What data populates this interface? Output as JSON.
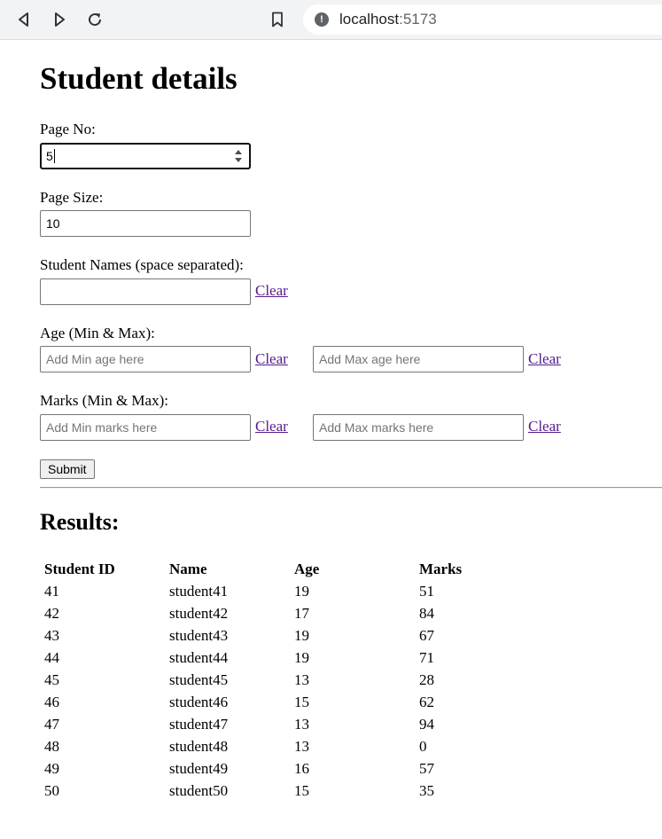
{
  "browser": {
    "url_host": "localhost",
    "url_port": ":5173"
  },
  "page": {
    "title": "Student details",
    "page_no": {
      "label": "Page No:",
      "value": "5"
    },
    "page_size": {
      "label": "Page Size:",
      "value": "10"
    },
    "names": {
      "label": "Student Names (space separated):",
      "value": "",
      "clear_label": "Clear"
    },
    "age": {
      "label": "Age (Min & Max):",
      "min_placeholder": "Add Min age here",
      "max_placeholder": "Add Max age here",
      "clear_label": "Clear"
    },
    "marks": {
      "label": "Marks (Min & Max):",
      "min_placeholder": "Add Min marks here",
      "max_placeholder": "Add Max marks here",
      "clear_label": "Clear"
    },
    "submit_label": "Submit",
    "results_title": "Results:"
  },
  "table": {
    "headers": [
      "Student ID",
      "Name",
      "Age",
      "Marks"
    ],
    "rows": [
      [
        "41",
        "student41",
        "19",
        "51"
      ],
      [
        "42",
        "student42",
        "17",
        "84"
      ],
      [
        "43",
        "student43",
        "19",
        "67"
      ],
      [
        "44",
        "student44",
        "19",
        "71"
      ],
      [
        "45",
        "student45",
        "13",
        "28"
      ],
      [
        "46",
        "student46",
        "15",
        "62"
      ],
      [
        "47",
        "student47",
        "13",
        "94"
      ],
      [
        "48",
        "student48",
        "13",
        "0"
      ],
      [
        "49",
        "student49",
        "16",
        "57"
      ],
      [
        "50",
        "student50",
        "15",
        "35"
      ]
    ]
  }
}
